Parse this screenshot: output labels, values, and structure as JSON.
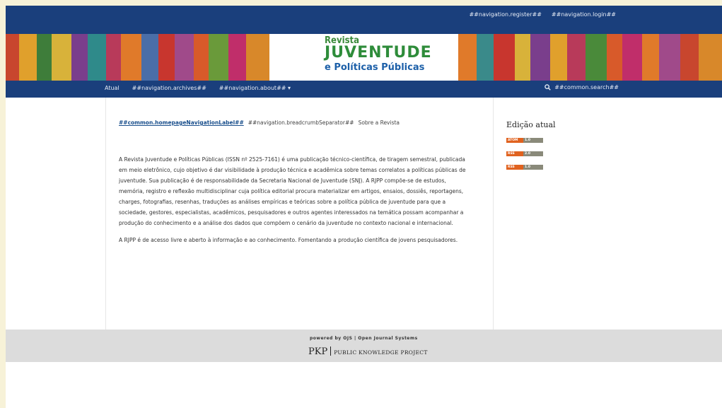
{
  "user_nav": {
    "register": "##navigation.register##",
    "login": "##navigation.login##"
  },
  "logo": {
    "line1": "Revista",
    "line2_a": "JUVENTUDE",
    "line3": "e Políticas Públicas"
  },
  "primary_nav": {
    "current": "Atual",
    "archives": "##navigation.archives##",
    "about": "##navigation.about## ▾",
    "search": "##common.search##"
  },
  "breadcrumb": {
    "home": "##common.homepageNavigationLabel##",
    "separator": "##navigation.breadcrumbSeparator##",
    "current": "Sobre a Revista"
  },
  "about": {
    "p1": "A Revista Juventude e Políticas Públicas (ISSN nº 2525-7161) é uma publicação técnico-científica, de tiragem semestral, publicada em meio eletrônico, cujo objetivo é dar visibilidade à produção técnica e acadêmica sobre temas correlatos a políticas públicas de juventude. Sua publicação é de responsabilidade da Secretaria Nacional de Juventude (SNJ). A RJPP compõe-se de estudos, memória, registro e reflexão multidisciplinar cuja política editorial procura materializar em artigos, ensaios, dossiês, reportagens, charges, fotografias, resenhas, traduções as análises empíricas e teóricas sobre a política pública de juventude para que a sociedade, gestores, especialistas, acadêmicos, pesquisadores e outros agentes interessados na temática possam acompanhar a produção do conhecimento e a análise dos dados que compõem o cenário da juventude no contexto nacional e internacional.",
    "p2": "A RJPP é de acesso livre e aberto à informação e ao conhecimento. Fomentando a produção científica de jovens pesquisadores."
  },
  "sidebar": {
    "title": "Edição atual",
    "feeds": [
      {
        "a": "ATOM",
        "b": "1.0"
      },
      {
        "a": "RSS",
        "b": "2.0"
      },
      {
        "a": "RSS",
        "b": "1.0"
      }
    ]
  },
  "footer": {
    "ojs": "powered by OJS | Open Journal Systems",
    "pkp": "PKP",
    "pkp_full": "PUBLIC KNOWLEDGE PROJECT"
  },
  "colors": {
    "nav_blue": "#1a3f7c",
    "footer_gray": "#dcdcdc",
    "feed_orange": "#e0621f"
  }
}
